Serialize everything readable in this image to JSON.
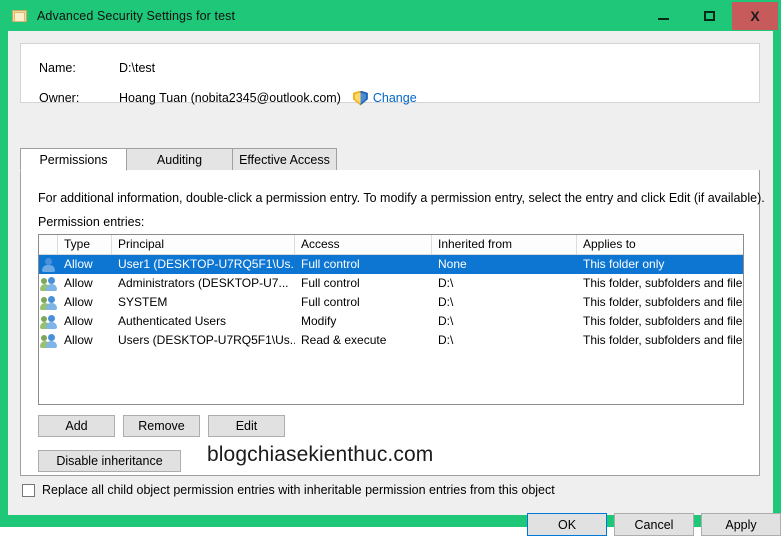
{
  "window": {
    "title": "Advanced Security Settings for test",
    "icon": "folder-icon",
    "frame_color": "#1ec878",
    "caption": {
      "minimize": "—",
      "maximize": "□",
      "close": "X",
      "close_color": "#c75b5b"
    }
  },
  "header": {
    "name_label": "Name:",
    "name_value": "D:\\test",
    "owner_label": "Owner:",
    "owner_value": "Hoang Tuan (nobita2345@outlook.com)",
    "change_link": "Change",
    "change_link_color": "#0066cc",
    "shield_icon": "uac-shield-icon"
  },
  "tabs": [
    {
      "label": "Permissions",
      "active": true
    },
    {
      "label": "Auditing",
      "active": false
    },
    {
      "label": "Effective Access",
      "active": false
    }
  ],
  "main": {
    "instruction": "For additional information, double-click a permission entry. To modify a permission entry, select the entry and click Edit (if available).",
    "entries_label": "Permission entries:"
  },
  "table": {
    "columns": [
      "",
      "Type",
      "Principal",
      "Access",
      "Inherited from",
      "Applies to"
    ],
    "selected_row_index": 0,
    "selection_color": "#0c76d2",
    "rows": [
      {
        "icon": "user-icon",
        "type": "Allow",
        "principal": "User1 (DESKTOP-U7RQ5F1\\Us...",
        "access": "Full control",
        "inherited_from": "None",
        "applies_to": "This folder only"
      },
      {
        "icon": "group-icon",
        "type": "Allow",
        "principal": "Administrators (DESKTOP-U7...",
        "access": "Full control",
        "inherited_from": "D:\\",
        "applies_to": "This folder, subfolders and files"
      },
      {
        "icon": "group-icon",
        "type": "Allow",
        "principal": "SYSTEM",
        "access": "Full control",
        "inherited_from": "D:\\",
        "applies_to": "This folder, subfolders and files"
      },
      {
        "icon": "group-icon",
        "type": "Allow",
        "principal": "Authenticated Users",
        "access": "Modify",
        "inherited_from": "D:\\",
        "applies_to": "This folder, subfolders and files"
      },
      {
        "icon": "group-icon",
        "type": "Allow",
        "principal": "Users (DESKTOP-U7RQ5F1\\Us...",
        "access": "Read & execute",
        "inherited_from": "D:\\",
        "applies_to": "This folder, subfolders and files"
      }
    ]
  },
  "actions": {
    "add": "Add",
    "remove": "Remove",
    "edit": "Edit",
    "disable_inheritance": "Disable inheritance"
  },
  "watermark": "blogchiasekienthuc.com",
  "replace_option": {
    "label": "Replace all child object permission entries with inheritable permission entries from this object",
    "checked": false
  },
  "footer": {
    "ok": "OK",
    "cancel": "Cancel",
    "apply": "Apply",
    "default_button": "OK"
  }
}
